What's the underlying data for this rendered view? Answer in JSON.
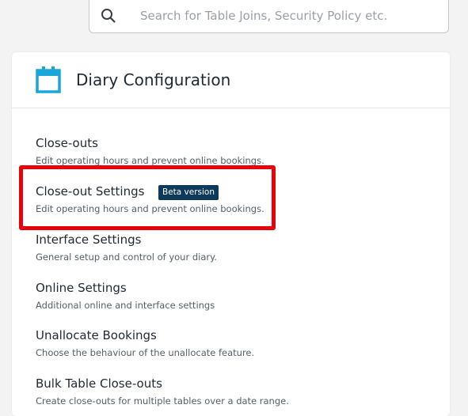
{
  "search": {
    "placeholder": "Search for Table Joins, Security Policy etc.",
    "value": "",
    "icon": "search-icon"
  },
  "card": {
    "title": "Diary Configuration",
    "icon": "calendar-icon",
    "accent_color": "#1aa6d9",
    "items": [
      {
        "title": "Close-outs",
        "description": "Edit operating hours and prevent online bookings."
      },
      {
        "title": "Close-out Settings",
        "badge": "Beta version",
        "description": "Edit operating hours and prevent online bookings."
      },
      {
        "title": "Interface Settings",
        "description": "General setup and control of your diary."
      },
      {
        "title": "Online Settings",
        "description": "Additional online and interface settings"
      },
      {
        "title": "Unallocate Bookings",
        "description": "Choose the behaviour of the unallocate feature."
      },
      {
        "title": "Bulk Table Close-outs",
        "description": "Create close-outs for multiple tables over a date range."
      }
    ]
  },
  "annotation": {
    "highlight_color": "#e8000b"
  },
  "colors": {
    "badge_bg": "#0d3a5a",
    "page_bg": "#f3f3f3"
  }
}
